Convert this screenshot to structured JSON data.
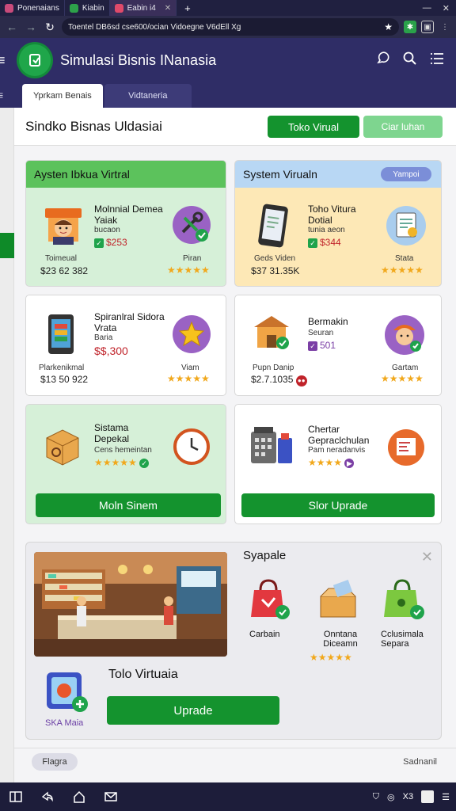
{
  "browser": {
    "tabs": [
      {
        "label": "Ponenaians",
        "color": "#c94b7b"
      },
      {
        "label": "Kiabin",
        "color": "#2da14a"
      },
      {
        "label": "Eabin i4",
        "color": "#e04a6a"
      }
    ],
    "url": "Toentel DB6sd cse600/ocian Vidoegne V6dEll Xg"
  },
  "header": {
    "title": "Simulasi Bisnis INanasia"
  },
  "page_tabs": [
    "Yprkam Benais",
    "Vidtaneria"
  ],
  "toolbar": {
    "page_title": "Sindko Bisnas Uldasiai",
    "primary_button": "Toko Virual",
    "secondary_button": "Ciar luhan"
  },
  "cards": {
    "c1": {
      "header": "Aysten Ibkua Virtral",
      "item_title": "Molnnial Demea Yaiak",
      "item_sub": "bucaon",
      "item_price": "$253",
      "left_label": "Toimeual",
      "left_value": "$23 62 382",
      "right_label": "Piran",
      "stars": "★★★★★"
    },
    "c2": {
      "header": "System Virualn",
      "pill": "Yampoi",
      "item_title": "Toho Vitura Dotial",
      "item_sub": "tunia aeon",
      "item_price": "$344",
      "left_label": "Geds Viden",
      "left_value": "$37 31.35K",
      "right_label": "Stata",
      "stars": "★★★★★"
    },
    "c3": {
      "item_title": "Spiranlral Sidora Vrata",
      "item_sub": "Baria",
      "item_price": "$$,300",
      "left_label": "Plarkenikmal",
      "left_value": "$13 50 922",
      "right_label": "Viam",
      "stars": "★★★★★"
    },
    "c4": {
      "item_title": "Bermakin",
      "item_sub": "Seuran",
      "item_price": "501",
      "left_label": "Pupn Danip",
      "left_value": "$2.7.1035",
      "right_label": "Gartam",
      "stars": "★★★★★"
    },
    "c5": {
      "item_title": "Sistama Depekal",
      "item_sub": "Cens hemeintan",
      "stars": "★★★★★",
      "button": "Moln Sinem"
    },
    "c6": {
      "item_title": "Chertar Gepraclchulan",
      "item_sub": "Pam neradanvis",
      "stars": "★★★★",
      "button": "Slor Uprade"
    }
  },
  "showcase": {
    "section_title": "Syapale",
    "products": [
      {
        "label": "Carbain"
      },
      {
        "label": "Onntana Diceamn",
        "stars": "★★★★★"
      },
      {
        "label": "Cclusimala Separa"
      }
    ],
    "store_title": "Tolo Virtuaia",
    "app_label": "SKA Maia",
    "upgrade_button": "Uprade"
  },
  "footer": {
    "chip": "Flagra",
    "right_text": "Sadnanil"
  },
  "taskbar": {
    "tray_text": "X3"
  },
  "colors": {
    "header": "#2f2d66",
    "accent_green": "#14932e",
    "card_green": "#d6f0d8",
    "card_yellow": "#fde8b6"
  }
}
